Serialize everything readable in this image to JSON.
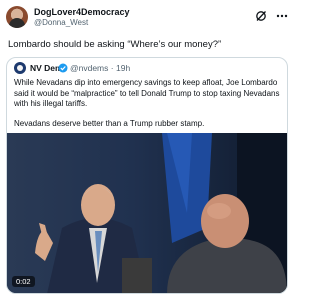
{
  "post": {
    "author_name": "DogLover4Democracy",
    "author_handle": "@Donna_West",
    "text": "Lombardo should be asking “Where’s our money?”"
  },
  "quoted": {
    "author_name": "NV Dems",
    "author_handle": "@nvdems",
    "age": "19h",
    "paragraphs": [
      "While Nevadans dip into emergency savings to keep afloat, Joe Lombardo said it would be “malpractice” to tell Donald Trump to stop taxing Nevadans with his illegal tariffs.",
      "Nevadans deserve better than a Trump rubber stamp."
    ]
  },
  "video": {
    "duration": "0:02"
  },
  "icons": {
    "ai": "grok-icon",
    "more": "more-options-icon",
    "verified": "verified-badge-icon"
  },
  "colors": {
    "text_primary": "#0f1419",
    "text_secondary": "#536471",
    "border": "#cfd9de"
  }
}
